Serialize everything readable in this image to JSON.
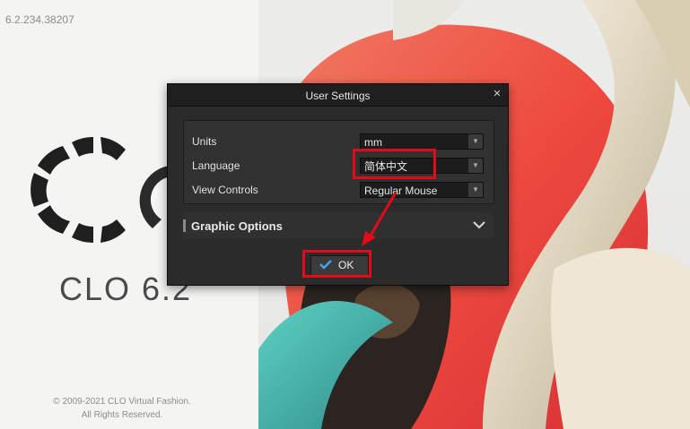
{
  "splash": {
    "version": "6.2.234.38207",
    "brand_text": "CLO 6.2",
    "copyright_line1": "© 2009-2021 CLO Virtual Fashion.",
    "copyright_line2": "All Rights Reserved."
  },
  "dialog": {
    "title": "User Settings",
    "close_icon": "close-icon",
    "settings": [
      {
        "label": "Units",
        "value": "mm"
      },
      {
        "label": "Language",
        "value": "简体中文"
      },
      {
        "label": "View Controls",
        "value": "Regular Mouse"
      }
    ],
    "graphic_options_label": "Graphic Options",
    "ok_label": "OK"
  },
  "colors": {
    "annotation": "#e00b1b",
    "dialog_bg": "#2b2b2c",
    "accent_check": "#4aa3e8"
  }
}
